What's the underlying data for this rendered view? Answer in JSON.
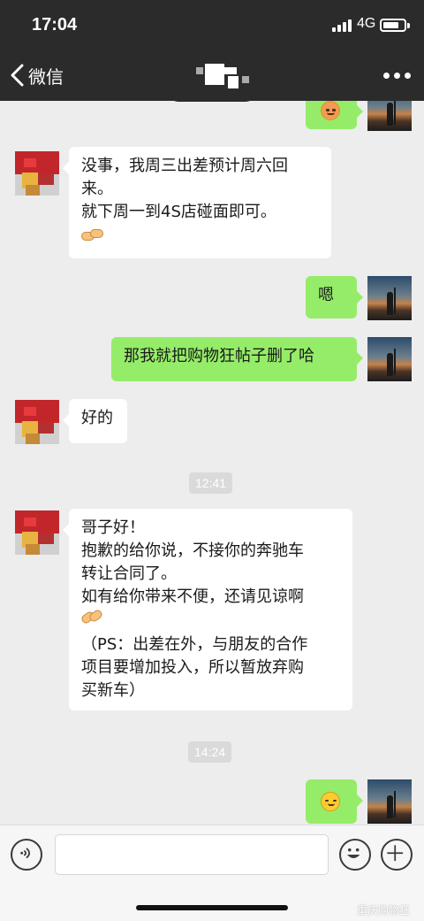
{
  "status_bar": {
    "time": "17:04",
    "network": "4G",
    "battery_level": 0.66
  },
  "header": {
    "back_label": "微信",
    "back_icon": "chevron-left-icon",
    "more_icon": "more-dots-icon"
  },
  "messages": [
    {
      "side": "out",
      "type": "emoji",
      "emoji": "blushing-face-emoji"
    },
    {
      "side": "in",
      "lines": [
        "没事，我周三出差预计周六回",
        "来。",
        "就下周一到4S店碰面即可。"
      ],
      "emoji": "handshake-emoji"
    },
    {
      "side": "out",
      "lines": [
        "嗯"
      ]
    },
    {
      "side": "out",
      "lines": [
        "那我就把购物狂帖子删了哈"
      ]
    },
    {
      "side": "in",
      "lines": [
        "好的"
      ]
    },
    {
      "type": "time",
      "text": "12:41"
    },
    {
      "side": "in",
      "lines": [
        "哥子好！",
        "抱歉的给你说，不接你的奔驰车",
        "转让合同了。",
        "如有给你带来不便，还请见谅啊",
        "（PS：出差在外，与朋友的合作",
        "项目要增加投入，所以暂放弃购",
        "买新车）"
      ],
      "emoji": "folded-hands-emoji"
    },
    {
      "type": "time",
      "text": "14:24"
    },
    {
      "side": "out",
      "type": "emoji",
      "emoji": "smirk-face-emoji"
    }
  ],
  "footer": {
    "voice_icon": "voice-icon",
    "emoji_icon": "emoji-icon",
    "plus_icon": "plus-icon",
    "input_value": ""
  },
  "watermark": "重庆购物狂",
  "colors": {
    "header": "#2b2b2b",
    "chat_bg": "#ededed",
    "bubble_out": "#95ec69",
    "bubble_in": "#ffffff"
  }
}
